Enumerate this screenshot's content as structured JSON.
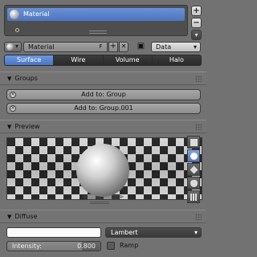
{
  "material_slots": {
    "items": [
      {
        "name": "Material"
      }
    ]
  },
  "side_buttons": {
    "add": "+",
    "remove": "−",
    "menu": "▾"
  },
  "datablock": {
    "name": "Material",
    "fake_user": "F",
    "add": "+",
    "unlink": "✕",
    "link_target": "Data"
  },
  "type_tabs": {
    "items": [
      "Surface",
      "Wire",
      "Volume",
      "Halo"
    ],
    "active": "Surface"
  },
  "panels": {
    "groups": {
      "title": "Groups",
      "buttons": [
        "Add to: Group",
        "Add to: Group.001"
      ]
    },
    "preview": {
      "title": "Preview"
    },
    "diffuse": {
      "title": "Diffuse",
      "color": "#fafafa",
      "intensity_label": "Intensity:",
      "intensity_value": "0.800",
      "intensity_fraction": 0.8,
      "shader": "Lambert",
      "ramp_label": "Ramp"
    }
  },
  "colors": {
    "active_blue": "#5a82cc",
    "panel_bg": "#727272"
  }
}
